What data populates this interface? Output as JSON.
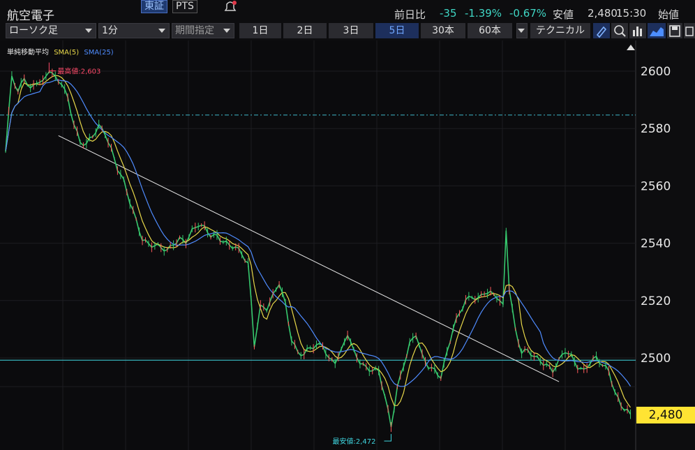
{
  "header": {
    "stock_name": "航空電子",
    "exchange_active": "東証",
    "exchange_pts": "PTS",
    "change_label": "前日比",
    "change_value": "-35",
    "change_pct": "-1.39%",
    "change_pct2": "-0.67%",
    "low_label": "安値",
    "low_value": "2,480",
    "time": "15:30",
    "open_label": "始値"
  },
  "toolbar": {
    "chart_type": "ローソク足",
    "interval": "1分",
    "period_select": "期間指定",
    "periods": [
      "1日",
      "2日",
      "3日",
      "5日",
      "30本",
      "60本"
    ],
    "active_period": "5日",
    "technical_label": "テクニカル"
  },
  "chart_data": {
    "type": "line",
    "indicator_label": "単純移動平均",
    "series": [
      {
        "name": "SMA(5)",
        "color": "#e8d84a"
      },
      {
        "name": "SMA(25)",
        "color": "#4f8cff"
      }
    ],
    "price_path": [
      [
        0,
        2572
      ],
      [
        2,
        2598
      ],
      [
        4,
        2592
      ],
      [
        6,
        2598
      ],
      [
        8,
        2594
      ],
      [
        10,
        2597
      ],
      [
        12,
        2596
      ],
      [
        14,
        2600
      ],
      [
        16,
        2597
      ],
      [
        18,
        2596
      ],
      [
        20,
        2591
      ],
      [
        22,
        2582
      ],
      [
        24,
        2575
      ],
      [
        26,
        2574
      ],
      [
        28,
        2577
      ],
      [
        30,
        2581
      ],
      [
        32,
        2579
      ],
      [
        34,
        2573
      ],
      [
        36,
        2566
      ],
      [
        38,
        2561
      ],
      [
        40,
        2554
      ],
      [
        42,
        2548
      ],
      [
        44,
        2542
      ],
      [
        46,
        2540
      ],
      [
        48,
        2539
      ],
      [
        50,
        2538
      ],
      [
        52,
        2537
      ],
      [
        54,
        2540
      ],
      [
        56,
        2542
      ],
      [
        58,
        2541
      ],
      [
        60,
        2544
      ],
      [
        62,
        2546
      ],
      [
        64,
        2545
      ],
      [
        66,
        2543
      ],
      [
        68,
        2543
      ],
      [
        70,
        2541
      ],
      [
        72,
        2539
      ],
      [
        74,
        2538
      ],
      [
        76,
        2536
      ],
      [
        78,
        2533
      ],
      [
        79,
        2520
      ],
      [
        80,
        2505
      ],
      [
        81,
        2512
      ],
      [
        82,
        2518
      ],
      [
        84,
        2517
      ],
      [
        86,
        2521
      ],
      [
        88,
        2526
      ],
      [
        90,
        2519
      ],
      [
        92,
        2507
      ],
      [
        94,
        2502
      ],
      [
        96,
        2501
      ],
      [
        98,
        2503
      ],
      [
        100,
        2504
      ],
      [
        102,
        2505
      ],
      [
        104,
        2500
      ],
      [
        106,
        2499
      ],
      [
        108,
        2502
      ],
      [
        110,
        2508
      ],
      [
        112,
        2502
      ],
      [
        114,
        2499
      ],
      [
        116,
        2497
      ],
      [
        118,
        2496
      ],
      [
        120,
        2495
      ],
      [
        122,
        2486
      ],
      [
        124,
        2476
      ],
      [
        126,
        2490
      ],
      [
        128,
        2498
      ],
      [
        130,
        2505
      ],
      [
        132,
        2508
      ],
      [
        134,
        2500
      ],
      [
        136,
        2497
      ],
      [
        138,
        2496
      ],
      [
        140,
        2494
      ],
      [
        142,
        2502
      ],
      [
        144,
        2510
      ],
      [
        146,
        2515
      ],
      [
        148,
        2520
      ],
      [
        150,
        2522
      ],
      [
        152,
        2521
      ],
      [
        154,
        2523
      ],
      [
        156,
        2522
      ],
      [
        158,
        2521
      ],
      [
        160,
        2518
      ],
      [
        161,
        2545
      ],
      [
        162,
        2525
      ],
      [
        164,
        2510
      ],
      [
        166,
        2502
      ],
      [
        168,
        2502
      ],
      [
        170,
        2500
      ],
      [
        172,
        2499
      ],
      [
        174,
        2498
      ],
      [
        176,
        2496
      ],
      [
        178,
        2499
      ],
      [
        180,
        2502
      ],
      [
        182,
        2500
      ],
      [
        184,
        2497
      ],
      [
        186,
        2496
      ],
      [
        188,
        2499
      ],
      [
        190,
        2500
      ],
      [
        192,
        2497
      ],
      [
        194,
        2495
      ],
      [
        196,
        2488
      ],
      [
        198,
        2484
      ],
      [
        200,
        2482
      ],
      [
        201,
        2480
      ]
    ],
    "y_ticks": [
      2600,
      2580,
      2560,
      2540,
      2520,
      2500
    ],
    "ylim": [
      2470,
      2610
    ],
    "high_label": "最高値:2,603",
    "high_value": 2603,
    "low_label": "最安値:2,472",
    "low_value": 2472,
    "ref_lines": [
      2584.7,
      2499.2
    ],
    "trendline": [
      [
        17,
        2577.5
      ],
      [
        178,
        2491.7
      ]
    ],
    "current_price": "2,480",
    "current_value": 2480
  }
}
